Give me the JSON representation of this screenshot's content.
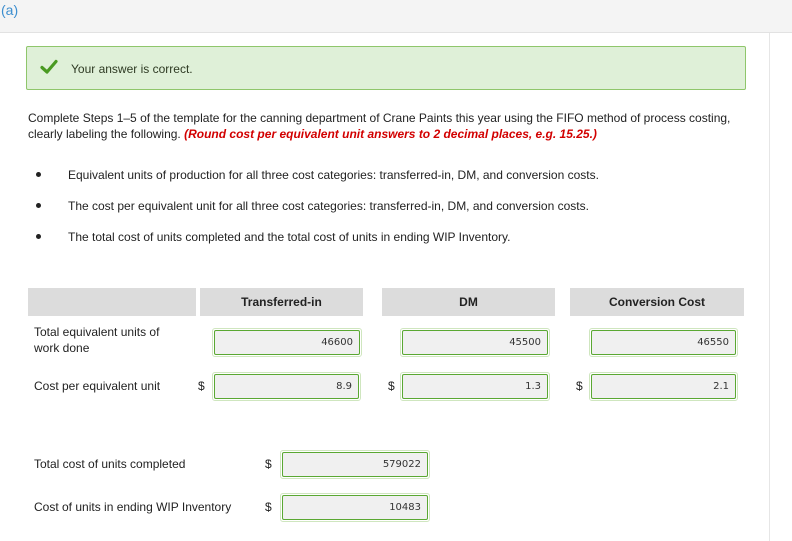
{
  "part": "(a)",
  "alert": {
    "message": "Your answer is correct.",
    "color": "#5aa832"
  },
  "instructions": {
    "text": "Complete Steps 1–5 of the template for the canning department of Crane Paints this year using the FIFO method of process costing, clearly labeling the following.",
    "hint": "(Round cost per equivalent unit answers to 2 decimal places, e.g. 15.25.)"
  },
  "bullets": [
    "Equivalent units of production for all three cost categories: transferred-in, DM, and conversion costs.",
    "The cost per equivalent unit for all three cost categories: transferred-in, DM, and conversion costs.",
    "The total cost of units completed and the total cost of units in ending WIP Inventory."
  ],
  "columns": {
    "transferred_in": "Transferred-in",
    "dm": "DM",
    "conversion": "Conversion Cost"
  },
  "rows": {
    "equiv_units": {
      "label": "Total equivalent units of work done",
      "transferred_in": "46600",
      "dm": "45500",
      "conversion": "46550"
    },
    "cost_per_unit": {
      "label": "Cost per equivalent unit",
      "currency": "$",
      "transferred_in": "8.9",
      "dm": "1.3",
      "conversion": "2.1"
    },
    "completed": {
      "label": "Total cost of units completed",
      "currency": "$",
      "value": "579022"
    },
    "ending_wip": {
      "label": "Cost of units in ending WIP Inventory",
      "currency": "$",
      "value": "10483"
    }
  }
}
